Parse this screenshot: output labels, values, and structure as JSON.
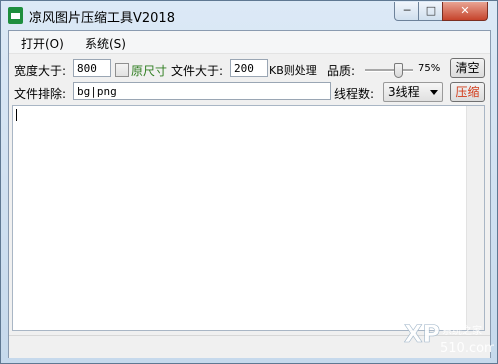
{
  "window": {
    "title": "凉风图片压缩工具V2018",
    "controls": {
      "minimize": "─",
      "maximize": "□",
      "close": "✕"
    }
  },
  "menu": {
    "open": "打开(O)",
    "system": "系统(S)"
  },
  "settings": {
    "width_label": "宽度大于:",
    "width_value": "800",
    "original_size_label": "原尺寸",
    "filesize_label": "文件大于:",
    "filesize_value": "200",
    "filesize_unit": "KB则处理",
    "quality_label": "品质:",
    "quality_value": "75%",
    "quality": 0.75,
    "clear_button": "清空"
  },
  "exclude": {
    "label": "文件排除:",
    "value": "bg|png",
    "threads_label": "线程数:",
    "threads_selected": "3线程",
    "compress_button": "压缩"
  },
  "log": {
    "text": ""
  },
  "watermark": {
    "text": "系统之家",
    "sub": "510.com"
  },
  "colors": {
    "original_size_text": "#2e7d1f",
    "compress_text": "#d23c1a",
    "app_icon": "#1e8e3e"
  }
}
